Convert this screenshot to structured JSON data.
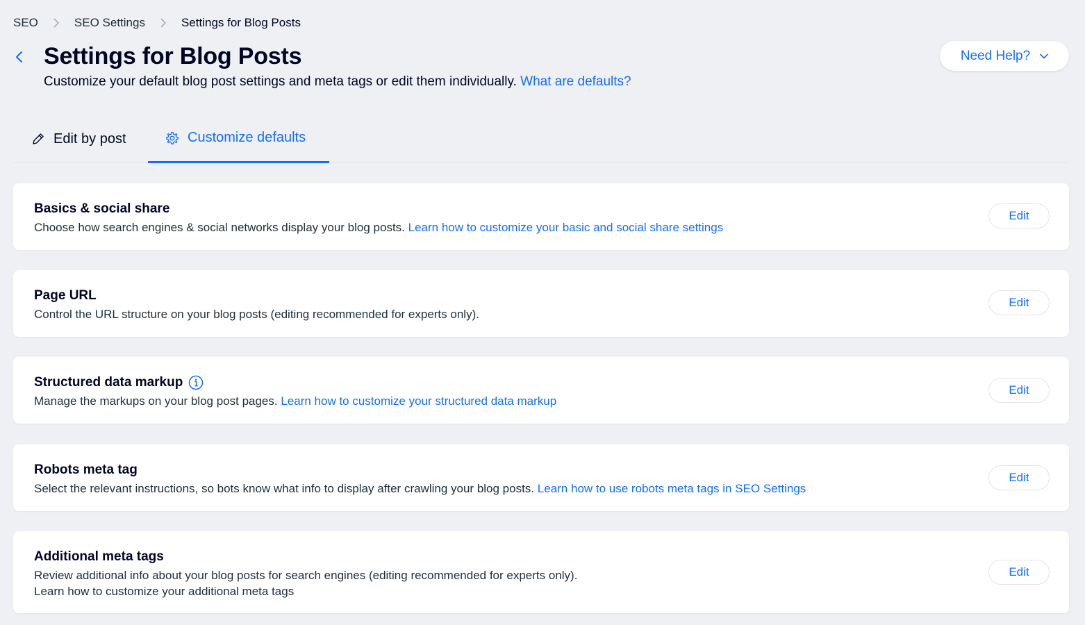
{
  "breadcrumb": {
    "items": [
      "SEO",
      "SEO Settings",
      "Settings for Blog Posts"
    ]
  },
  "header": {
    "title": "Settings for Blog Posts",
    "subtitle": "Customize your default blog post settings and meta tags or edit them individually.",
    "subtitle_link": "What are defaults?",
    "help_button": "Need Help?"
  },
  "tabs": [
    {
      "label": "Edit by post",
      "icon": "pencil-icon",
      "selected": false
    },
    {
      "label": "Customize defaults",
      "icon": "gear-icon",
      "selected": true
    }
  ],
  "cards": [
    {
      "title": "Basics & social share",
      "description": "Choose how search engines & social networks display your blog posts.",
      "link": "Learn how to customize your basic and social share settings",
      "button": "Edit"
    },
    {
      "title": "Page URL",
      "description": "Control the URL structure on your blog posts (editing recommended for experts only).",
      "link": "",
      "button": "Edit"
    },
    {
      "title": "Structured data markup",
      "description": "Manage the markups on your blog post pages.",
      "link": "Learn how to customize your structured data markup",
      "button": "Edit"
    },
    {
      "title": "Robots meta tag",
      "description": "Select the relevant instructions, so bots know what info to display after crawling your blog posts.",
      "link": "Learn how to use robots meta tags in SEO Settings",
      "button": "Edit"
    },
    {
      "title": "Additional meta tags",
      "description": "Review additional info about your blog posts for search engines (editing recommended for experts only).",
      "link": "Learn how to customize your additional meta tags",
      "button": "Edit"
    }
  ],
  "colors": {
    "background": "#eff0f4",
    "accent": "#116dff",
    "text": "#000624",
    "card": "#ffffff"
  }
}
